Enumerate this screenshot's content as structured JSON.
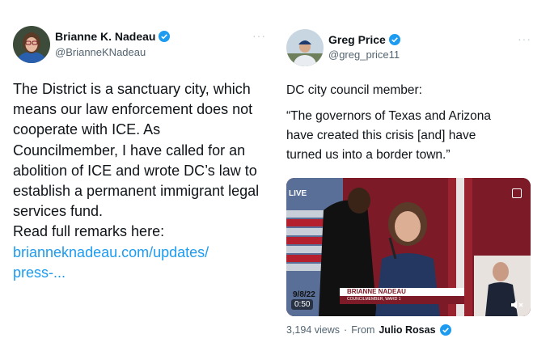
{
  "left_tweet": {
    "display_name": "Brianne K. Nadeau",
    "handle": "@BrianneKNadeau",
    "more_icon": "more-dots-icon",
    "body": "The District is a sanctuary city, which\nmeans our law enforcement does not\ncooperate with ICE. As\nCouncilmember, I have called for an\nabolition of ICE and wrote DC’s law to\nestablish a permanent immigrant legal\nservices fund.\nRead full remarks here:",
    "link": "brianneknadeau.com/updates/\npress-..."
  },
  "right_tweet": {
    "display_name": "Greg Price",
    "handle": "@greg_price11",
    "more_icon": "more-dots-icon",
    "intro": "DC city council member:",
    "quote": "“The governors of Texas and Arizona\nhave created this crisis [and] have\nturned us into a border town.”",
    "video": {
      "live_label": "LIVE",
      "date": "9/8/22",
      "lower_third_name": "BRIANNE NADEAU",
      "lower_third_title": "COUNCILMEMBER, WARD 1",
      "duration": "0:50"
    },
    "views": "3,194 views",
    "separator": "·",
    "from_label": "From",
    "from_name": "Julio Rosas"
  },
  "colors": {
    "verified_blue": "#1d9bf0",
    "link_blue": "#1d9bf0",
    "muted_text": "#536471",
    "video_red": "#8b1a26"
  }
}
